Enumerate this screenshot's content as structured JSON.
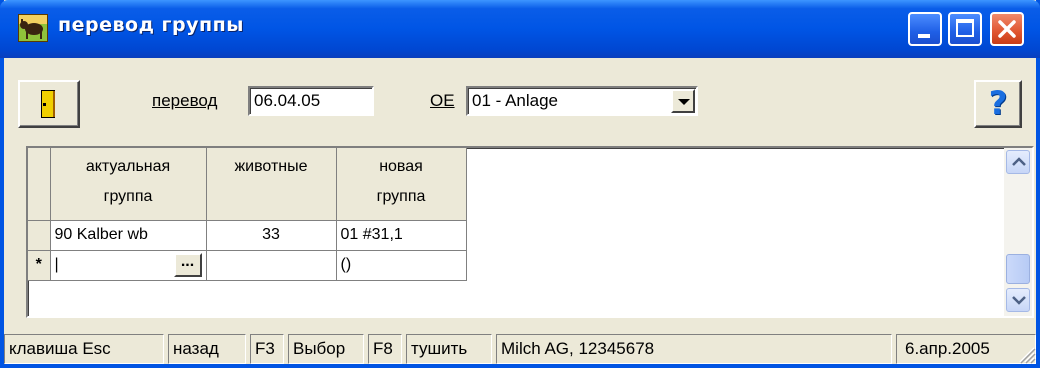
{
  "window": {
    "title": "перевод группы"
  },
  "toolbar": {
    "transfer_label": "перевод",
    "transfer_date": "06.04.05",
    "oe_label": "OE",
    "oe_selected": "01 - Anlage",
    "help_label": "?"
  },
  "grid": {
    "columns": [
      "актуальная группа",
      "животные",
      "новая группа"
    ],
    "column_lines": [
      [
        "актуальная",
        "группа"
      ],
      [
        "животные"
      ],
      [
        "новая",
        "группа"
      ]
    ],
    "rows": [
      {
        "current_group": "90 Kalber wb",
        "animals": "33",
        "new_group": "01 #31,1"
      }
    ],
    "new_row": {
      "marker": "*",
      "current_group": "|",
      "lookup_label": "...",
      "animals": "",
      "new_group": "()"
    }
  },
  "statusbar": {
    "items": [
      {
        "text": "клавиша Esc"
      },
      {
        "text": "назад"
      },
      {
        "text": "F3"
      },
      {
        "text": "Выбор"
      },
      {
        "text": "F8"
      },
      {
        "text": "тушить"
      },
      {
        "text": "Milch AG, 12345678"
      },
      {
        "text": "6.апр.2005"
      }
    ]
  },
  "colors": {
    "titlebar": "#0055e5",
    "window_face": "#ece9d8",
    "close_button": "#e0552f",
    "help_icon": "#1a6ee0"
  },
  "icons": {
    "app": "cow-icon",
    "exit": "door-exit-icon",
    "help": "help-question-icon"
  }
}
